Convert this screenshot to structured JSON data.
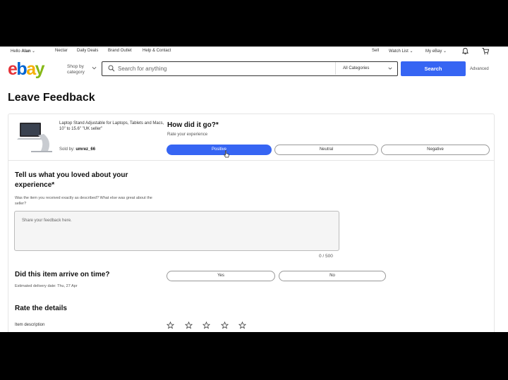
{
  "utility_nav": {
    "hello_prefix": "Hello",
    "user_name": "Alan",
    "links": [
      "Nectar",
      "Daily Deals",
      "Brand Outlet",
      "Help & Contact"
    ],
    "right_links": [
      "Sell",
      "Watch List",
      "My eBay"
    ],
    "chevron": "⌄"
  },
  "header": {
    "logo": {
      "e": "e",
      "b": "b",
      "a": "a",
      "y": "y"
    },
    "shop_by_category": "Shop by category",
    "search_placeholder": "Search for anything",
    "category_select": "All Categories",
    "search_button": "Search",
    "advanced": "Advanced"
  },
  "page_title": "Leave Feedback",
  "item": {
    "title": "Laptop Stand Adjustable for Laptops, Tablets and Macs, 10\" to 15.6\" \"UK seller\"",
    "sold_by_label": "Sold by:",
    "seller": "umrez_66"
  },
  "rating": {
    "question": "How did it go?*",
    "subtitle": "Rate your experience",
    "options": [
      "Positive",
      "Neutral",
      "Negative"
    ],
    "selected": "Positive"
  },
  "feedback": {
    "question": "Tell us what you loved about your experience*",
    "subtitle": "Was the item you received exactly as described? What else was great about the seller?",
    "placeholder": "Share your feedback here.",
    "counter": "0 / 500"
  },
  "on_time": {
    "question": "Did this item arrive on time?",
    "subtitle": "Estimated delivery date: Thu, 27 Apr",
    "options": [
      "Yes",
      "No"
    ]
  },
  "details": {
    "heading": "Rate the details",
    "item_description_label": "Item description",
    "stars": 5
  },
  "colors": {
    "accent": "#3665f3",
    "ebay_red": "#e53238",
    "ebay_blue": "#0064d2",
    "ebay_yellow": "#f5af02",
    "ebay_green": "#86b817"
  }
}
